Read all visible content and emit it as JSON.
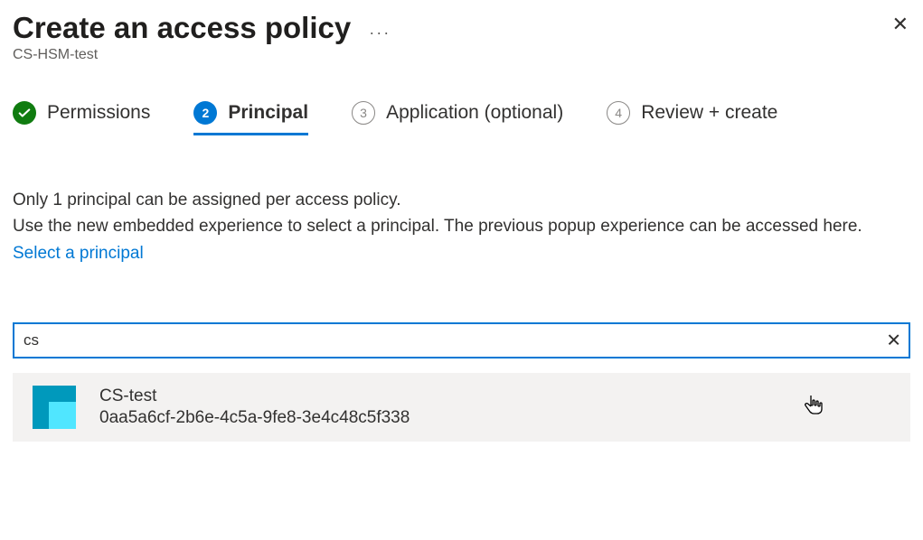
{
  "header": {
    "title": "Create an access policy",
    "subtitle": "CS-HSM-test",
    "more_glyph": "···",
    "close_glyph": "✕"
  },
  "stepper": {
    "steps": [
      {
        "label": "Permissions",
        "state": "done",
        "number": ""
      },
      {
        "label": "Principal",
        "state": "current",
        "number": "2"
      },
      {
        "label": "Application (optional)",
        "state": "future",
        "number": "3"
      },
      {
        "label": "Review + create",
        "state": "future",
        "number": "4"
      }
    ]
  },
  "info": {
    "line1": "Only 1 principal can be assigned per access policy.",
    "line2_prefix": "Use the new embedded experience to select a principal. The previous popup experience can be accessed here. ",
    "link": "Select a principal"
  },
  "search": {
    "value": "cs",
    "clear_glyph": "✕"
  },
  "result": {
    "name": "CS-test",
    "id": "0aa5a6cf-2b6e-4c5a-9fe8-3e4c48c5f338"
  }
}
